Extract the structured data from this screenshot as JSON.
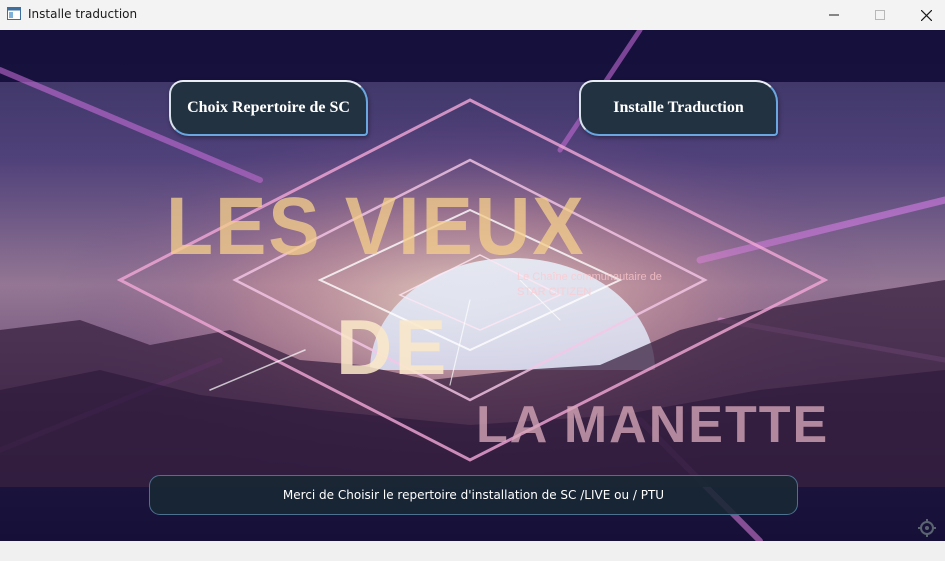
{
  "window": {
    "title": "Installe traduction",
    "controls": {
      "minimize": "minimize-icon",
      "maximize": "maximize-icon",
      "close": "close-icon"
    }
  },
  "logo": {
    "line1": "LES VIEUX",
    "line2": "DE",
    "line3": "LA MANETTE",
    "tagline1": "Le Chaîne communautaire de",
    "tagline2": "STAR CITIZEN"
  },
  "buttons": {
    "choose_dir": "Choix Repertoire de SC",
    "install": "Installe Traduction"
  },
  "status": {
    "message": "Merci de Choisir le repertoire d'installation de SC /LIVE ou / PTU"
  },
  "colors": {
    "button_bg": "#233241",
    "button_border": "#6aa7e0",
    "status_bg": "#182834",
    "status_border": "#4d7190"
  }
}
